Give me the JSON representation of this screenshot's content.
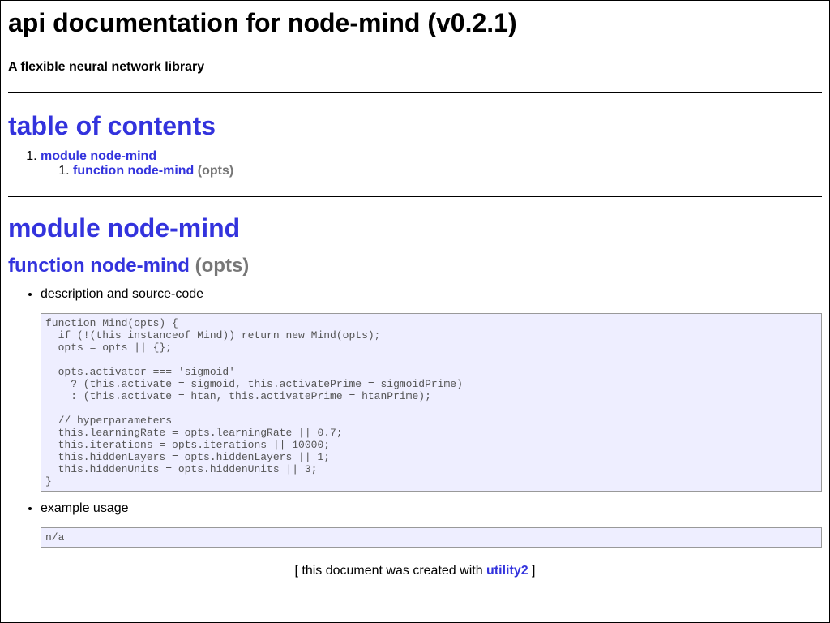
{
  "header": {
    "title": "api documentation for node-mind (v0.2.1)",
    "subtitle": "A flexible neural network library"
  },
  "toc": {
    "title": "table of contents",
    "module_link": "module node-mind",
    "function_link": "function node-mind",
    "function_args": "(opts)"
  },
  "module": {
    "title": "module node-mind",
    "function_name": "function node-mind",
    "function_args": "(opts)"
  },
  "sections": {
    "description_label": "description and source-code",
    "source_code": "function Mind(opts) {\n  if (!(this instanceof Mind)) return new Mind(opts);\n  opts = opts || {};\n\n  opts.activator === 'sigmoid'\n    ? (this.activate = sigmoid, this.activatePrime = sigmoidPrime)\n    : (this.activate = htan, this.activatePrime = htanPrime);\n\n  // hyperparameters\n  this.learningRate = opts.learningRate || 0.7;\n  this.iterations = opts.iterations || 10000;\n  this.hiddenLayers = opts.hiddenLayers || 1;\n  this.hiddenUnits = opts.hiddenUnits || 3;\n}",
    "usage_label": "example usage",
    "usage_code": "n/a"
  },
  "footer": {
    "prefix": "[ this document was created with ",
    "link": "utility2",
    "suffix": " ]"
  }
}
